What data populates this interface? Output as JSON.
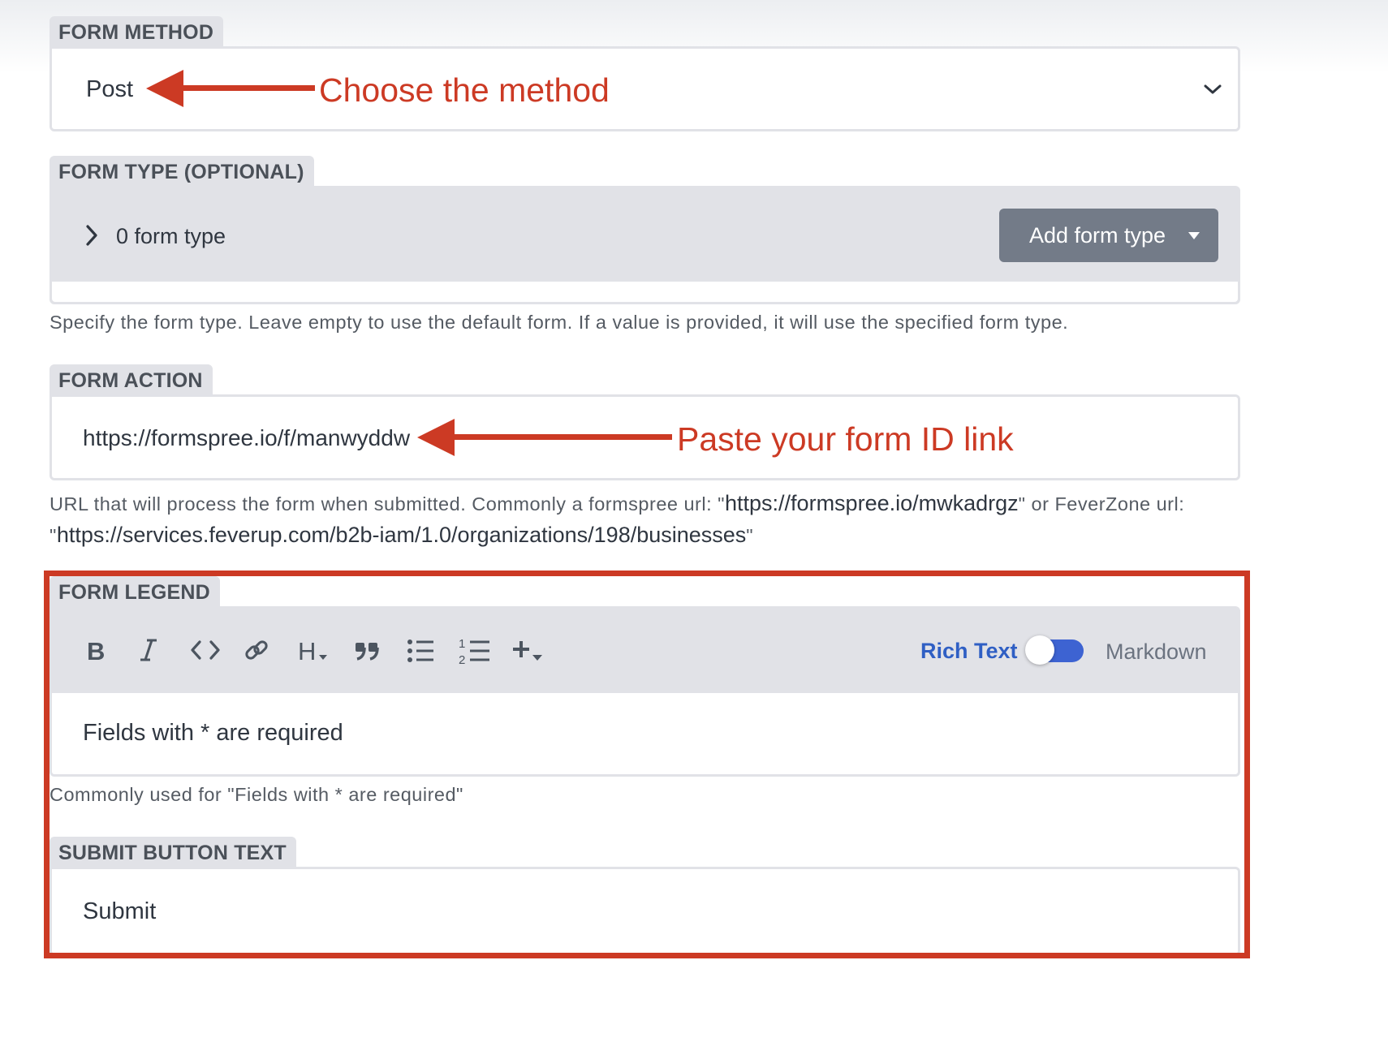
{
  "form_method": {
    "label": "FORM METHOD",
    "value": "Post",
    "annotation": "Choose the method"
  },
  "form_type": {
    "label": "FORM TYPE (OPTIONAL)",
    "count_text": "0 form type",
    "add_button": "Add form type",
    "help": "Specify the form type. Leave empty to use the default form. If a value is provided, it will use the specified form type."
  },
  "form_action": {
    "label": "FORM ACTION",
    "value": "https://formspree.io/f/manwyddw",
    "annotation": "Paste your form ID link",
    "help_part1": "URL that will process the form when submitted. Commonly a formspree url: \"",
    "help_url1": "https://formspree.io/mwkadrgz",
    "help_part2": "\" or FeverZone url:",
    "help_part3": "\"",
    "help_url2": "https://services.feverup.com/b2b-iam/1.0/organizations/198/businesses",
    "help_part4": "\""
  },
  "form_legend": {
    "label": "FORM LEGEND",
    "toolbar": {
      "bold": "B",
      "heading": "H",
      "rich_text": "Rich Text",
      "markdown": "Markdown"
    },
    "value": "Fields with * are required",
    "help": "Commonly used for \"Fields with * are required\""
  },
  "submit_button_text": {
    "label": "SUBMIT BUTTON TEXT",
    "value": "Submit"
  },
  "colors": {
    "annotation_red": "#cc3a24",
    "label_bg": "#e1e2e7",
    "toggle_blue": "#3d63d2",
    "rich_text_blue": "#2f5fc4",
    "button_gray": "#737b88"
  },
  "icons": [
    "chevron-down-icon",
    "chevron-right-icon",
    "caret-down-icon",
    "bold-icon",
    "italic-icon",
    "code-icon",
    "link-icon",
    "heading-icon",
    "quote-icon",
    "bullet-list-icon",
    "numbered-list-icon",
    "plus-icon"
  ]
}
